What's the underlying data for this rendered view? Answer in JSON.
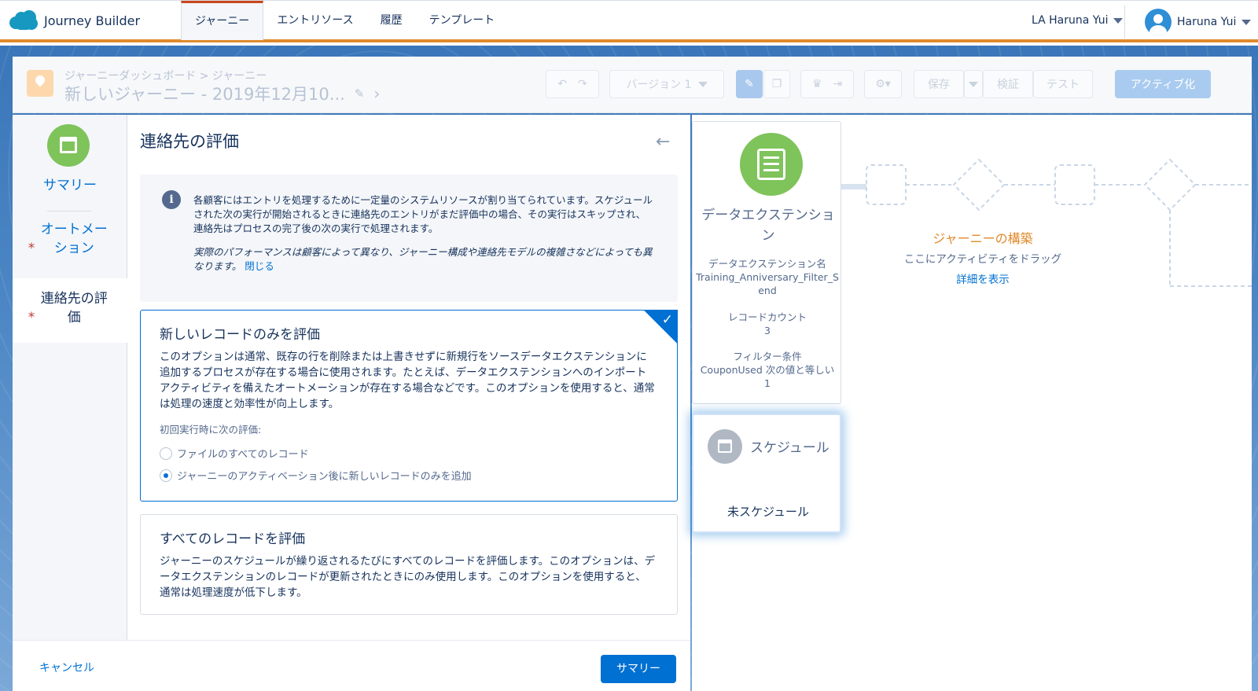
{
  "app": {
    "name": "Journey Builder"
  },
  "nav": {
    "tabs": [
      {
        "label": "ジャーニー",
        "active": true
      },
      {
        "label": "エントリソース"
      },
      {
        "label": "履歴"
      },
      {
        "label": "テンプレート"
      }
    ],
    "org": "LA Haruna Yui",
    "user": "Haruna Yui"
  },
  "journey": {
    "breadcrumb": "ジャーニーダッシュボード > ジャーニー",
    "title": "新しいジャーニー - 2019年12月10...",
    "toolbar": {
      "version_label": "バージョン 1",
      "save_label": "保存",
      "validate_label": "検証",
      "test_label": "テスト",
      "activate_label": "アクティブ化"
    }
  },
  "left_nav": {
    "items": [
      {
        "label": "サマリー",
        "required": false
      },
      {
        "label": "オートメーション",
        "required": true
      },
      {
        "label": "連絡先の評価",
        "required": true,
        "active": true
      }
    ],
    "required_marker": "*"
  },
  "panel": {
    "title": "連絡先の評価",
    "info": {
      "text": "各顧客にはエントリを処理するために一定量のシステムリソースが割り当てられています。スケジュールされた次の実行が開始されるときに連絡先のエントリがまだ評価中の場合、その実行はスキップされ、連絡先はプロセスの完了後の次の実行で処理されます。",
      "note": "実際のパフォーマンスは顧客によって異なり、ジャーニー構成や連絡先モデルの複雑さなどによっても異なります。",
      "close": "閉じる"
    },
    "option_new": {
      "title": "新しいレコードのみを評価",
      "description": "このオプションは通常、既存の行を削除または上書きせずに新規行をソースデータエクステンションに追加するプロセスが存在する場合に使用されます。たとえば、データエクステンションへのインポートアクティビティを備えたオートメーションが存在する場合などです。このオプションを使用すると、通常は処理の速度と効率性が向上します。",
      "sub_label": "初回実行時に次の評価:",
      "radio_all": "ファイルのすべてのレコード",
      "radio_new": "ジャーニーのアクティベーション後に新しいレコードのみを追加",
      "selected_radio": "radio_new"
    },
    "option_all": {
      "title": "すべてのレコードを評価",
      "description": "ジャーニーのスケジュールが繰り返されるたびにすべてのレコードを評価します。このオプションは、データエクステンションのレコードが更新されたときにのみ使用します。このオプションを使用すると、通常は処理速度が低下します。"
    }
  },
  "footer": {
    "cancel": "キャンセル",
    "summary": "サマリー"
  },
  "canvas": {
    "entry": {
      "title": "データエクステンション",
      "de_name_label": "データエクステンション名",
      "de_name": "Training_Anniversary_Filter_Send",
      "record_count_label": "レコードカウント",
      "record_count": "3",
      "filter_label": "フィルター条件",
      "filter_value": "CouponUsed 次の値と等しい",
      "filter_operand": "1"
    },
    "schedule": {
      "title": "スケジュール",
      "status": "未スケジュール"
    },
    "build": {
      "title": "ジャーニーの構築",
      "subtitle": "ここにアクティビティをドラッグ",
      "link": "詳細を表示"
    }
  },
  "colors": {
    "accent": "#0070d2",
    "brand_orange": "#e08a2c",
    "activity_green": "#7fc35b"
  }
}
